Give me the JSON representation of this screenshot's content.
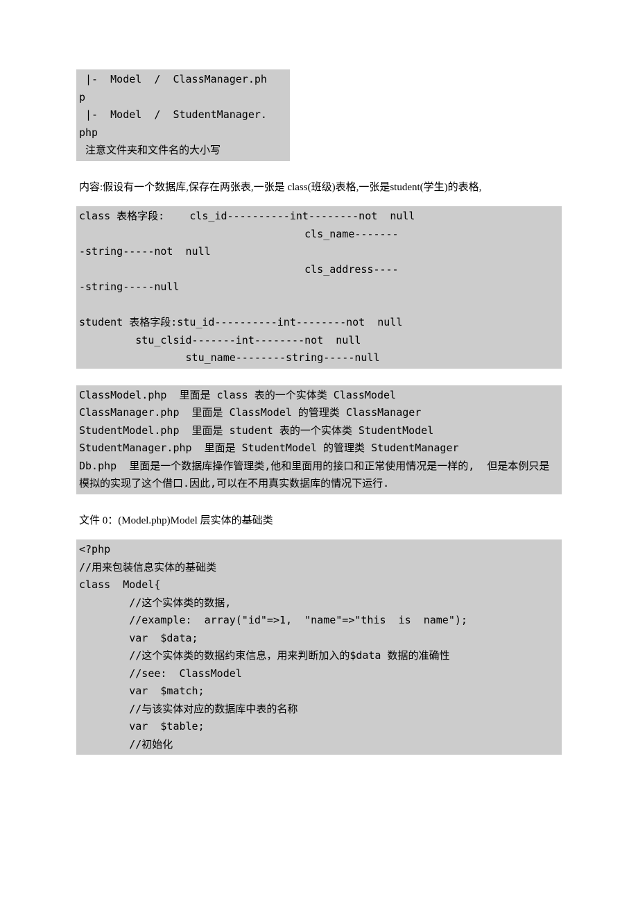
{
  "block1": " |-  Model  /  ClassManager.ph\np\n |-  Model  /  StudentManager.\nphp\n 注意文件夹和文件名的大小写",
  "intro": "内容:假设有一个数据库,保存在两张表,一张是 class(班级)表格,一张是student(学生)的表格,",
  "block2": "class 表格字段:    cls_id----------int--------not  null\n                                    cls_name-------\n-string-----not  null\n                                    cls_address----\n-string-----null\n\nstudent 表格字段:stu_id----------int--------not  null\n         stu_clsid-------int--------not  null\n                 stu_name--------string-----null",
  "block3": "ClassModel.php  里面是 class 表的一个实体类 ClassModel\nClassManager.php  里面是 ClassModel 的管理类 ClassManager\nStudentModel.php  里面是 student 表的一个实体类 StudentModel\nStudentManager.php  里面是 StudentModel 的管理类 StudentManager\nDb.php  里面是一个数据库操作管理类,他和里面用的接口和正常使用情况是一样的,  但是本例只是模拟的实现了这个借口.因此,可以在不用真实数据库的情况下运行.",
  "heading": "文件 0：(Model.php)Model 层实体的基础类",
  "block4": "<?php\n//用来包装信息实体的基础类\nclass  Model{\n        //这个实体类的数据,\n        //example:  array(\"id\"=>1,  \"name\"=>\"this  is  name\");\n        var  $data;\n        //这个实体类的数据约束信息，用来判断加入的$data 数据的准确性\n        //see:  ClassModel\n        var  $match;\n        //与该实体对应的数据库中表的名称\n        var  $table;\n        //初始化"
}
